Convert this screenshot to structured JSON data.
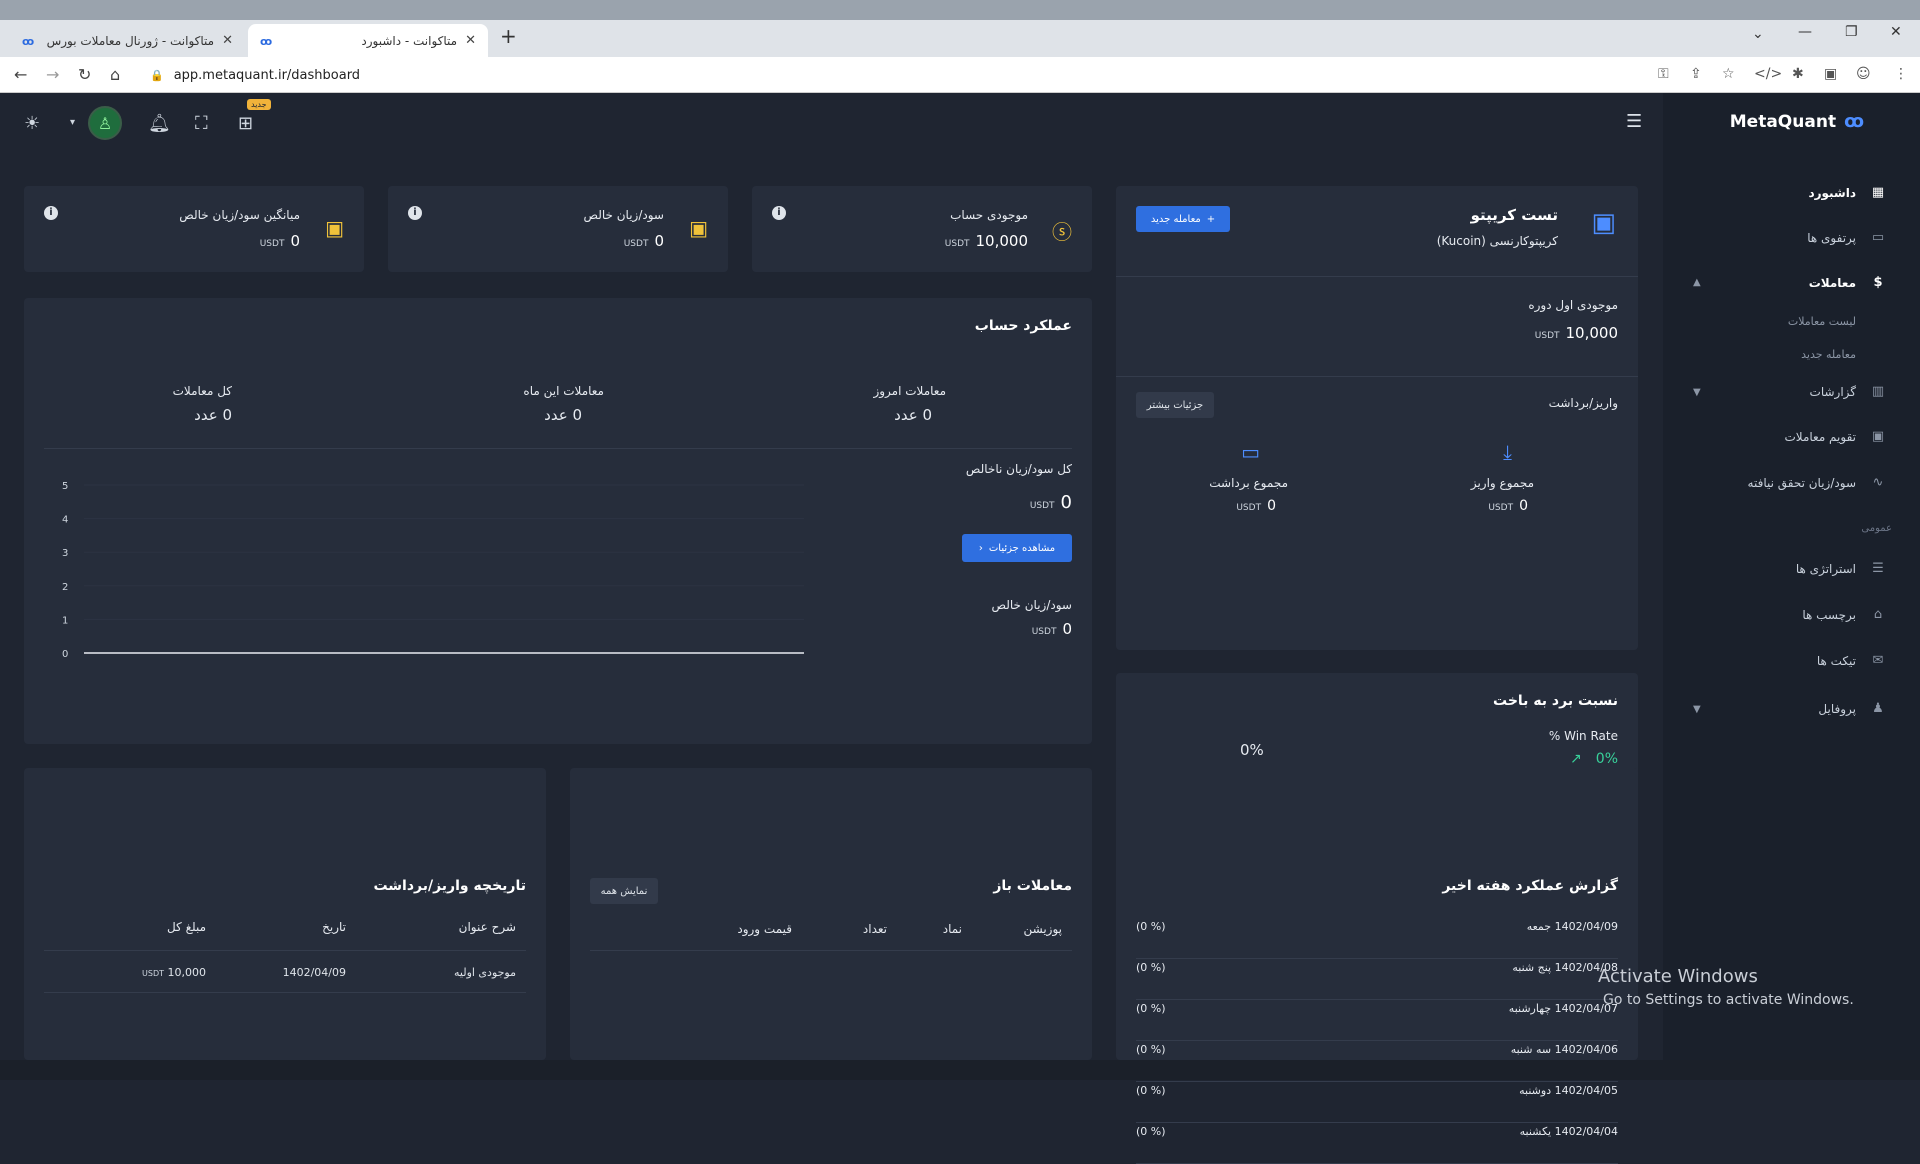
{
  "browser": {
    "tabs": [
      {
        "title": "متاکوانت - ژورنال معاملات بورس، ا",
        "icon": "metaquant-icon"
      },
      {
        "title": "متاکوانت - داشبورد",
        "icon": "metaquant-icon"
      }
    ],
    "url": "app.metaquant.ir/dashboard"
  },
  "header": {
    "new_badge": "جدید"
  },
  "sidebar": {
    "brand": "MetaQuant",
    "items": [
      {
        "label": "داشبورد",
        "icon": "dashboard-icon"
      },
      {
        "label": "پرتفوی ها",
        "icon": "portfolio-icon"
      },
      {
        "label": "معاملات",
        "icon": "dollar-circle-icon"
      },
      {
        "label": "لیست معاملات"
      },
      {
        "label": "معامله جدید"
      },
      {
        "label": "گزارشات",
        "icon": "bar-chart-icon"
      },
      {
        "label": "تقویم معاملات",
        "icon": "calendar-icon"
      },
      {
        "label": "سود/زیان تحقق نیافته",
        "icon": "trend-icon"
      },
      {
        "label": "استراتژی ها",
        "icon": "sliders-icon"
      },
      {
        "label": "برچسب ها",
        "icon": "tag-icon"
      },
      {
        "label": "تیکت ها",
        "icon": "mail-icon"
      },
      {
        "label": "پروفایل",
        "icon": "user-icon"
      }
    ],
    "section_general": "عمومی"
  },
  "stats": [
    {
      "title": "موجودی حساب",
      "value": "10,000",
      "unit": "USDT"
    },
    {
      "title": "سود/زیان خالص",
      "value": "0",
      "unit": "USDT"
    },
    {
      "title": "میانگین سود/زیان خالص",
      "value": "0",
      "unit": "USDT"
    }
  ],
  "portfolio": {
    "title": "تست کریپتو",
    "subtitle": "کریپتوکارنسی (Kucoin)",
    "new_trade_btn": "معامله جدید",
    "initial_balance_label": "موجودی اول دوره",
    "initial_balance": "10,000",
    "unit": "USDT",
    "deposit_withdraw_label": "واریز/برداشت",
    "more_details_btn": "جزئیات بیشتر",
    "total_withdraw_label": "مجموع برداشت",
    "total_withdraw": "0",
    "total_deposit_label": "مجموع واریز",
    "total_deposit": "0"
  },
  "performance": {
    "title": "عملکرد حساب",
    "today_label": "معاملات امروز",
    "today_value": "0 عدد",
    "month_label": "معاملات این ماه",
    "month_value": "0 عدد",
    "total_label": "کل معاملات",
    "total_value": "0 عدد",
    "gross_label": "کل سود/زیان ناخالص",
    "gross_value": "0",
    "unit": "USDT",
    "view_details_btn": "مشاهده جزئیات",
    "net_label": "سود/زیان خالص",
    "net_value": "0"
  },
  "chart_data": {
    "type": "line",
    "x": [],
    "series": [
      {
        "values": []
      }
    ],
    "ylim": [
      0,
      5
    ],
    "yticks": [
      "0",
      "1",
      "2",
      "3",
      "4",
      "5"
    ]
  },
  "winrate": {
    "title": "نسبت برد به باخت",
    "label": "% Win Rate",
    "value": "0%",
    "gauge_value": "0%"
  },
  "weekly": {
    "title": "گزارش عملکرد هفته اخیر",
    "rows": [
      {
        "date": "1402/04/09 جمعه",
        "pct": "(% 0)"
      },
      {
        "date": "1402/04/08 پنج شنبه",
        "pct": "(% 0)"
      },
      {
        "date": "1402/04/07 چهارشنبه",
        "pct": "(% 0)"
      },
      {
        "date": "1402/04/06 سه شنبه",
        "pct": "(% 0)"
      },
      {
        "date": "1402/04/05 دوشنبه",
        "pct": "(% 0)"
      },
      {
        "date": "1402/04/04 یکشنبه",
        "pct": "(% 0)"
      }
    ]
  },
  "open_trades": {
    "title": "معاملات باز",
    "show_all_btn": "نمایش همه",
    "columns": [
      "پوزیشن",
      "نماد",
      "تعداد",
      "قیمت ورود"
    ]
  },
  "history": {
    "title": "تاریخچه واریز/برداشت",
    "columns": [
      "شرح عنوان",
      "تاریخ",
      "مبلغ کل"
    ],
    "rows": [
      {
        "desc": "موجودی اولیه",
        "date": "1402/04/09",
        "amount": "10,000",
        "unit": "USDT"
      }
    ]
  },
  "watermark": {
    "line1": "Activate Windows",
    "line2": "Go to Settings to activate Windows."
  }
}
